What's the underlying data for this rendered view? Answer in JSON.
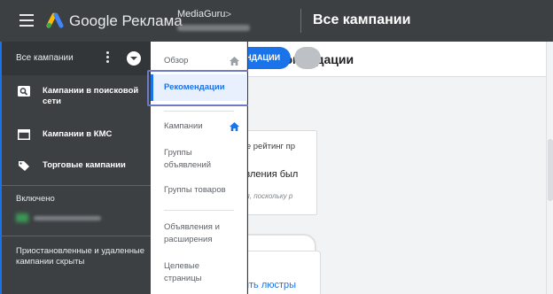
{
  "topbar": {
    "brand": "Google Реклама",
    "account_name": "MediaGuru",
    "account_chevron": ">",
    "page_title": "Все кампании"
  },
  "sidebar": {
    "all_campaigns": "Все кампании",
    "items": [
      {
        "label": "Кампании в поисковой сети",
        "icon": "search-campaign-icon"
      },
      {
        "label": "Кампании в КМС",
        "icon": "display-campaign-icon"
      },
      {
        "label": "Торговые кампании",
        "icon": "shopping-tag-icon"
      }
    ],
    "enabled_label": "Включено",
    "paused_label": "Приостановленные и удаленные кампании скрыты"
  },
  "page_nav": {
    "items": [
      {
        "label": "Обзор",
        "home": true
      },
      {
        "label": "Рекомендации",
        "active": true
      },
      {
        "label": "Кампании",
        "home": true
      },
      {
        "label": "Группы объявлений"
      },
      {
        "label": "Группы товаров"
      },
      {
        "label": "Объявления и расширения"
      },
      {
        "label": "Целевые страницы"
      }
    ]
  },
  "main": {
    "title": "Рекомендации",
    "all_recommendations_button": "ВСЕ РЕКОМЕНДАЦИИ",
    "card": {
      "top_text": "Добавьте рейтинг пр",
      "title": "Ваши объявления был",
      "note": "Рекомендуется, поскольку р",
      "star_glyph": "★"
    },
    "card2_link": "Купить люстры"
  },
  "colors": {
    "accent": "#1a73e8",
    "dark_bar": "#3c4043",
    "star": "#fbbc04",
    "highlight_box": "#6e7bc4"
  }
}
